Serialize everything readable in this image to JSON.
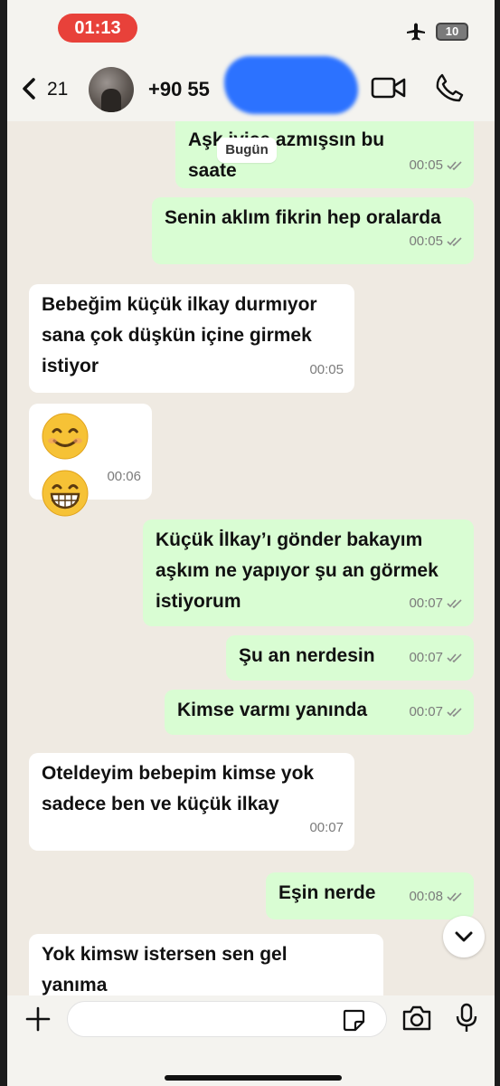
{
  "status_bar": {
    "time": "01:13",
    "battery": "10"
  },
  "header": {
    "back_count": "21",
    "contact_number": "+90 55"
  },
  "date_chip": "Bugün",
  "messages": [
    {
      "dir": "out",
      "text": "Aşk  iyice azmışsın bu\nsaate",
      "time": "00:05"
    },
    {
      "dir": "out",
      "text": "Senin aklım fikrin hep oralarda",
      "time": "00:05"
    },
    {
      "dir": "in",
      "text": "Bebeğim küçük ilkay durmıyor\nsana çok düşkün içine girmek\nistiyor",
      "time": "00:05"
    },
    {
      "dir": "in",
      "emojis": [
        "smiling-face-icon",
        "grinning-face-icon"
      ],
      "time": "00:06"
    },
    {
      "dir": "out",
      "text": "Küçük İlkay’ı gönder  bakayım\naşkım ne yapıyor şu an görmek\nistiyorum",
      "time": "00:07"
    },
    {
      "dir": "out",
      "text": "Şu an nerdesin",
      "time": "00:07"
    },
    {
      "dir": "out",
      "text": "Kimse varmı yanında",
      "time": "00:07"
    },
    {
      "dir": "in",
      "text": "Oteldeyim bebepim kimse yok\nsadece ben ve küçük ilkay",
      "time": "00:07"
    },
    {
      "dir": "out",
      "text": "Eşin nerde",
      "time": "00:08"
    },
    {
      "dir": "in",
      "text": "Yok kimsw istersen sen gel\nyanıma"
    }
  ],
  "input": {
    "value": "",
    "placeholder": ""
  },
  "colors": {
    "outgoing": "#d9fdd3",
    "incoming": "#ffffff",
    "background": "#efeae2",
    "time_pill": "#e8413a"
  }
}
